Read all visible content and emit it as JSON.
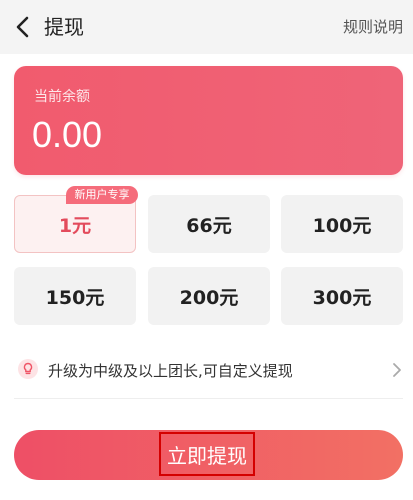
{
  "header": {
    "title": "提现",
    "rules_link": "规则说明",
    "back_icon": "chevron-left-icon"
  },
  "balance": {
    "label": "当前余额",
    "value": "0.00"
  },
  "amounts": [
    {
      "label": "1元",
      "badge": "新用户专享",
      "selected": true
    },
    {
      "label": "66元",
      "selected": false
    },
    {
      "label": "100元",
      "selected": false
    },
    {
      "label": "150元",
      "selected": false
    },
    {
      "label": "200元",
      "selected": false
    },
    {
      "label": "300元",
      "selected": false
    }
  ],
  "tip": {
    "text": "升级为中级及以上团长,可自定义提现",
    "icon": "lightbulb-icon"
  },
  "action": {
    "label": "立即提现"
  },
  "colors": {
    "accent": "#f15b6e",
    "selected_text": "#e34b5c",
    "badge": "#f56c7b"
  }
}
